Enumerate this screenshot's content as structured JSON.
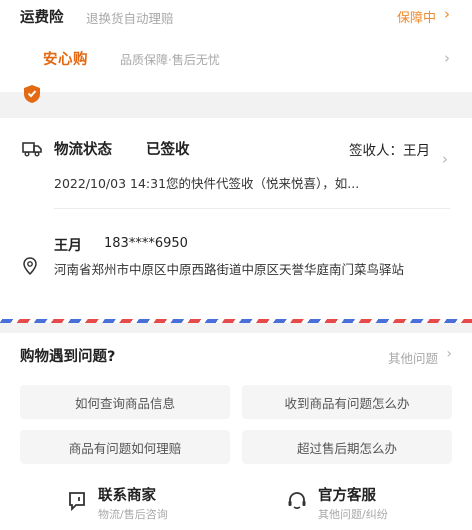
{
  "insurance": {
    "label": "运费险",
    "description": "退换货自动理赔",
    "status": "保障中"
  },
  "anxingou": {
    "label": "安心购",
    "description": "品质保障·售后无忧"
  },
  "logistics": {
    "title": "物流状态",
    "state": "已签收",
    "receiver": "签收人：王月",
    "detail": "2022/10/03 14:31您的快件代签收（悦来悦喜），如..."
  },
  "address": {
    "name": "王月",
    "phone": "183****6950",
    "text": "河南省郑州市中原区中原西路街道中原区天誉华庭南门菜鸟驿站"
  },
  "problems": {
    "title": "购物遇到问题?",
    "other_label": "其他问题",
    "questions": [
      "如何查询商品信息",
      "收到商品有问题怎么办",
      "商品有问题如何理赔",
      "超过售后期怎么办"
    ]
  },
  "services": [
    {
      "title": "联系商家",
      "subtitle": "物流/售后咨询",
      "icon": "merchant-chat-icon"
    },
    {
      "title": "官方客服",
      "subtitle": "其他问题/纠纷",
      "icon": "headset-icon"
    }
  ],
  "colors": {
    "accent_orange": "#f08a2c",
    "anxingou_orange": "#e36a12",
    "airmail_red": "#e74a4a",
    "airmail_blue": "#4a6fd8"
  }
}
